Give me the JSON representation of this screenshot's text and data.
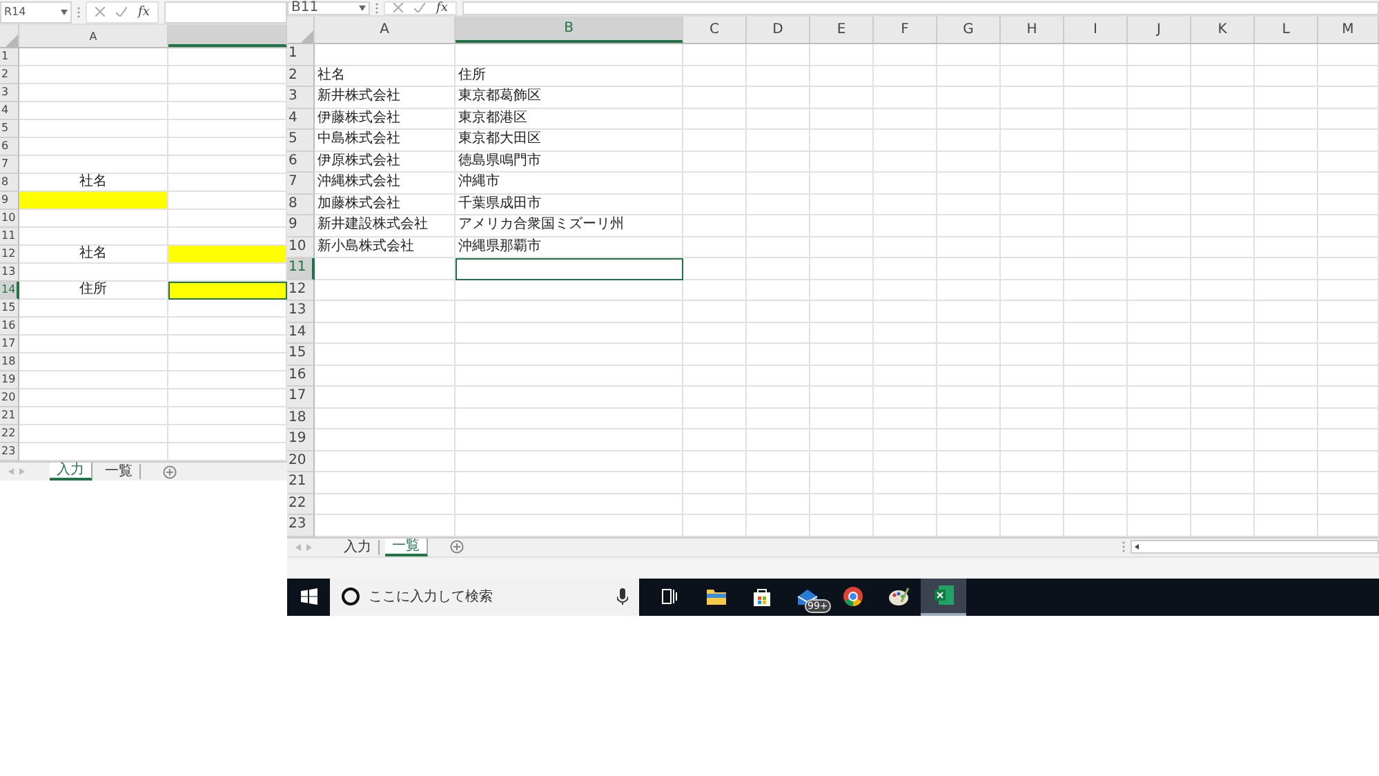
{
  "windows": [
    {
      "name_box": "R14",
      "function_label": "fx",
      "columns": [
        {
          "label": "A",
          "selected": false
        },
        {
          "selected": true
        }
      ],
      "rows": [
        {
          "number": "1",
          "selected": false,
          "cells": [
            {
              "selected": false,
              "highlighted": false
            },
            {
              "selected": false,
              "highlighted": false
            }
          ]
        },
        {
          "number": "2",
          "selected": false,
          "cells": [
            {
              "selected": false,
              "highlighted": false
            },
            {
              "selected": false,
              "highlighted": false
            }
          ]
        },
        {
          "number": "3",
          "selected": false,
          "cells": [
            {
              "selected": false,
              "highlighted": false
            },
            {
              "selected": false,
              "highlighted": false
            }
          ]
        },
        {
          "number": "4",
          "selected": false,
          "cells": [
            {
              "selected": false,
              "highlighted": false
            },
            {
              "selected": false,
              "highlighted": false
            }
          ]
        },
        {
          "number": "5",
          "selected": false,
          "cells": [
            {
              "selected": false,
              "highlighted": false
            },
            {
              "selected": false,
              "highlighted": false
            }
          ]
        },
        {
          "number": "6",
          "selected": false,
          "cells": [
            {
              "selected": false,
              "highlighted": false
            },
            {
              "selected": false,
              "highlighted": false
            }
          ]
        },
        {
          "number": "7",
          "selected": false,
          "cells": [
            {
              "selected": false,
              "highlighted": false
            },
            {
              "selected": false,
              "highlighted": false
            }
          ]
        },
        {
          "number": "8",
          "selected": false,
          "cells": [
            {
              "text": "社名",
              "selected": false,
              "highlighted": false
            },
            {
              "selected": false,
              "highlighted": false
            }
          ]
        },
        {
          "number": "9",
          "selected": false,
          "cells": [
            {
              "selected": false,
              "highlighted": true
            },
            {
              "selected": false,
              "highlighted": false
            }
          ]
        },
        {
          "number": "10",
          "selected": false,
          "cells": [
            {
              "selected": false,
              "highlighted": false
            },
            {
              "selected": false,
              "highlighted": false
            }
          ]
        },
        {
          "number": "11",
          "selected": false,
          "cells": [
            {
              "selected": false,
              "highlighted": false
            },
            {
              "selected": false,
              "highlighted": false
            }
          ]
        },
        {
          "number": "12",
          "selected": false,
          "cells": [
            {
              "text": "社名",
              "selected": false,
              "highlighted": false
            },
            {
              "selected": false,
              "highlighted": true
            }
          ]
        },
        {
          "number": "13",
          "selected": false,
          "cells": [
            {
              "selected": false,
              "highlighted": false
            },
            {
              "selected": false,
              "highlighted": false
            }
          ]
        },
        {
          "number": "14",
          "selected": true,
          "cells": [
            {
              "text": "住所",
              "selected": false,
              "highlighted": false
            },
            {
              "selected": true,
              "highlighted": true
            }
          ]
        },
        {
          "number": "15",
          "selected": false,
          "cells": [
            {
              "selected": false,
              "highlighted": false
            },
            {
              "selected": false,
              "highlighted": false
            }
          ]
        },
        {
          "number": "16",
          "selected": false,
          "cells": [
            {
              "selected": false,
              "highlighted": false
            },
            {
              "selected": false,
              "highlighted": false
            }
          ]
        },
        {
          "number": "17",
          "selected": false,
          "cells": [
            {
              "selected": false,
              "highlighted": false
            },
            {
              "selected": false,
              "highlighted": false
            }
          ]
        },
        {
          "number": "18",
          "selected": false,
          "cells": [
            {
              "selected": false,
              "highlighted": false
            },
            {
              "selected": false,
              "highlighted": false
            }
          ]
        },
        {
          "number": "19",
          "selected": false,
          "cells": [
            {
              "selected": false,
              "highlighted": false
            },
            {
              "selected": false,
              "highlighted": false
            }
          ]
        },
        {
          "number": "20",
          "selected": false,
          "cells": [
            {
              "selected": false,
              "highlighted": false
            },
            {
              "selected": false,
              "highlighted": false
            }
          ]
        },
        {
          "number": "21",
          "selected": false,
          "cells": [
            {
              "selected": false,
              "highlighted": false
            },
            {
              "selected": false,
              "highlighted": false
            }
          ]
        },
        {
          "number": "22",
          "selected": false,
          "cells": [
            {
              "selected": false,
              "highlighted": false
            },
            {
              "selected": false,
              "highlighted": false
            }
          ]
        },
        {
          "number": "23",
          "selected": false,
          "cells": [
            {
              "selected": false,
              "highlighted": false
            },
            {
              "selected": false,
              "highlighted": false
            }
          ]
        }
      ],
      "sheet_tabs": [
        {
          "label": "入力",
          "selected": true
        },
        {
          "label": "一覧",
          "selected": false
        }
      ]
    },
    {
      "name_box": "B11",
      "function_label": "fx",
      "columns": [
        {
          "label": "A",
          "selected": false
        },
        {
          "label": "B",
          "selected": true
        },
        {
          "label": "C",
          "selected": false
        },
        {
          "label": "D",
          "selected": false
        },
        {
          "label": "E",
          "selected": false
        },
        {
          "label": "F",
          "selected": false
        },
        {
          "label": "G",
          "selected": false
        },
        {
          "label": "H",
          "selected": false
        },
        {
          "label": "I",
          "selected": false
        },
        {
          "label": "J",
          "selected": false
        },
        {
          "label": "K",
          "selected": false
        },
        {
          "label": "L",
          "selected": false
        },
        {
          "label": "M",
          "selected": false
        }
      ],
      "rows": [
        {
          "number": "1",
          "selected": false,
          "cells": [
            {
              "selected": false
            },
            {
              "selected": false
            }
          ]
        },
        {
          "number": "2",
          "selected": false,
          "cells": [
            {
              "text": "社名",
              "selected": false
            },
            {
              "text": "住所",
              "selected": false
            }
          ]
        },
        {
          "number": "3",
          "selected": false,
          "cells": [
            {
              "text": "新井株式会社",
              "selected": false
            },
            {
              "text": "東京都葛飾区",
              "selected": false
            }
          ]
        },
        {
          "number": "4",
          "selected": false,
          "cells": [
            {
              "text": "伊藤株式会社",
              "selected": false
            },
            {
              "text": "東京都港区",
              "selected": false
            }
          ]
        },
        {
          "number": "5",
          "selected": false,
          "cells": [
            {
              "text": "中島株式会社",
              "selected": false
            },
            {
              "text": "東京都大田区",
              "selected": false
            }
          ]
        },
        {
          "number": "6",
          "selected": false,
          "cells": [
            {
              "text": "伊原株式会社",
              "selected": false
            },
            {
              "text": "徳島県鳴門市",
              "selected": false
            }
          ]
        },
        {
          "number": "7",
          "selected": false,
          "cells": [
            {
              "text": "沖縄株式会社",
              "selected": false
            },
            {
              "text": "沖縄市",
              "selected": false
            }
          ]
        },
        {
          "number": "8",
          "selected": false,
          "cells": [
            {
              "text": "加藤株式会社",
              "selected": false
            },
            {
              "text": "千葉県成田市",
              "selected": false
            }
          ]
        },
        {
          "number": "9",
          "selected": false,
          "cells": [
            {
              "text": "新井建設株式会社",
              "selected": false
            },
            {
              "text": "アメリカ合衆国ミズーリ州",
              "selected": false
            }
          ]
        },
        {
          "number": "10",
          "selected": false,
          "cells": [
            {
              "text": "新小島株式会社",
              "selected": false
            },
            {
              "text": "沖縄県那覇市",
              "selected": false
            }
          ]
        },
        {
          "number": "11",
          "selected": true,
          "cells": [
            {
              "selected": false
            },
            {
              "selected": true
            }
          ]
        },
        {
          "number": "12",
          "selected": false,
          "cells": [
            {
              "selected": false
            },
            {
              "selected": false
            }
          ]
        },
        {
          "number": "13",
          "selected": false,
          "cells": [
            {
              "selected": false
            },
            {
              "selected": false
            }
          ]
        },
        {
          "number": "14",
          "selected": false,
          "cells": [
            {
              "selected": false
            },
            {
              "selected": false
            }
          ]
        },
        {
          "number": "15",
          "selected": false,
          "cells": [
            {
              "selected": false
            },
            {
              "selected": false
            }
          ]
        },
        {
          "number": "16",
          "selected": false,
          "cells": [
            {
              "selected": false
            },
            {
              "selected": false
            }
          ]
        },
        {
          "number": "17",
          "selected": false,
          "cells": [
            {
              "selected": false
            },
            {
              "selected": false
            }
          ]
        },
        {
          "number": "18",
          "selected": false,
          "cells": [
            {
              "selected": false
            },
            {
              "selected": false
            }
          ]
        },
        {
          "number": "19",
          "selected": false,
          "cells": [
            {
              "selected": false
            },
            {
              "selected": false
            }
          ]
        },
        {
          "number": "20",
          "selected": false,
          "cells": [
            {
              "selected": false
            },
            {
              "selected": false
            }
          ]
        },
        {
          "number": "21",
          "selected": false,
          "cells": [
            {
              "selected": false
            },
            {
              "selected": false
            }
          ]
        },
        {
          "number": "22",
          "selected": false,
          "cells": [
            {
              "selected": false
            },
            {
              "selected": false
            }
          ]
        },
        {
          "number": "23",
          "selected": false,
          "cells": [
            {
              "selected": false
            },
            {
              "selected": false
            }
          ]
        }
      ],
      "sheet_tabs": [
        {
          "label": "入力",
          "selected": false
        },
        {
          "label": "一覧",
          "selected": true
        }
      ]
    }
  ],
  "taskbar": {
    "search": {
      "placeholder": "ここに入力して検索"
    },
    "apps": [
      {
        "kind": "task-view",
        "active": false
      },
      {
        "kind": "folder",
        "active": false
      },
      {
        "kind": "store",
        "active": false
      },
      {
        "kind": "mail",
        "active": false,
        "badge": "99+"
      },
      {
        "kind": "browser",
        "active": false
      },
      {
        "kind": "paint",
        "active": false
      },
      {
        "kind": "excel",
        "active": true
      }
    ]
  }
}
